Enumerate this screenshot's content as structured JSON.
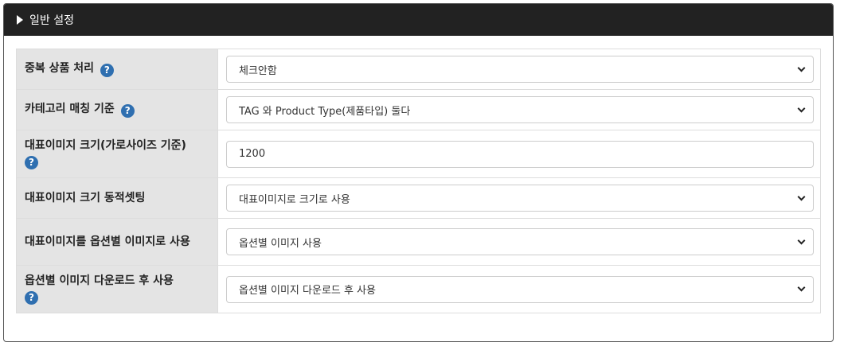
{
  "panel": {
    "title": "일반 설정"
  },
  "help_icon_glyph": "?",
  "rows": [
    {
      "label": "중복 상품 처리",
      "control": "select",
      "value": "체크안함"
    },
    {
      "label": "카테고리 매칭 기준",
      "control": "select",
      "value": "TAG 와 Product Type(제품타입) 둘다"
    },
    {
      "label": "대표이미지 크기(가로사이즈 기준)",
      "control": "input",
      "value": "1200"
    },
    {
      "label": "대표이미지 크기 동적셋팅",
      "control": "select",
      "value": "대표이미지로 크기로 사용"
    },
    {
      "label": "대표이미지를 옵션별 이미지로 사용",
      "control": "select",
      "value": "옵션별 이미지 사용"
    },
    {
      "label": "옵션별 이미지 다운로드 후 사용",
      "control": "select",
      "value": "옵션별 이미지 다운로드 후 사용"
    }
  ],
  "colors": {
    "header_bg": "#222222",
    "label_bg": "#e4e4e4",
    "help_icon": "#2f6fb0"
  }
}
